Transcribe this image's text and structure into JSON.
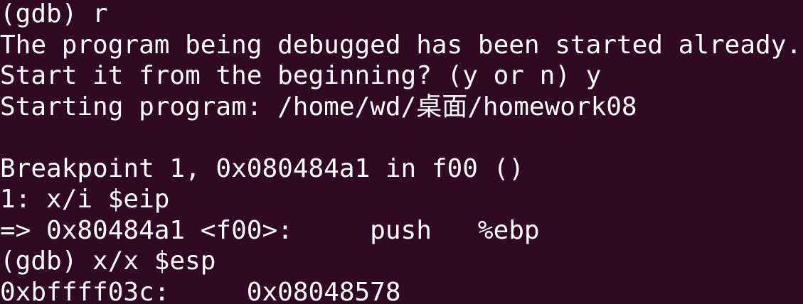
{
  "terminal": {
    "colors": {
      "background": "#300a24",
      "foreground": "#ffffff"
    },
    "lines": [
      "(gdb) r",
      "The program being debugged has been started already.",
      "Start it from the beginning? (y or n) y",
      "Starting program: /home/wd/桌面/homework08",
      "",
      "Breakpoint 1, 0x080484a1 in f00 ()",
      "1: x/i $eip",
      "=> 0x80484a1 <f00>:     push   %ebp",
      "(gdb) x/x $esp",
      "0xbffff03c:     0x08048578"
    ]
  }
}
